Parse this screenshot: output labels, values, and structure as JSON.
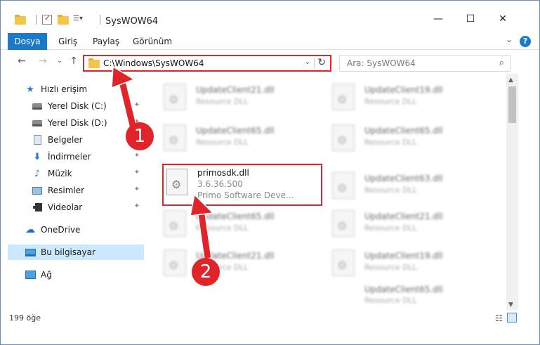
{
  "window": {
    "title": "SysWOW64",
    "minimize_glyph": "—",
    "maximize_glyph": "☐",
    "close_glyph": "✕"
  },
  "ribbon": {
    "tabs": [
      "Dosya",
      "Giriş",
      "Paylaş",
      "Görünüm"
    ],
    "help_glyph": "?",
    "expand_glyph": "⌄"
  },
  "address": {
    "path": "C:\\Windows\\SysWOW64",
    "dropdown_glyph": "⌄",
    "refresh_glyph": "↻"
  },
  "search": {
    "placeholder": "Ara: SysWOW64",
    "icon": "search-icon"
  },
  "nav_buttons": {
    "back": "←",
    "forward": "→",
    "recent": "⌄",
    "up": "↑"
  },
  "sidebar": {
    "items": [
      {
        "label": "Hızlı erişim",
        "icon": "star-icon"
      },
      {
        "label": "Yerel Disk (C:)",
        "icon": "drive-icon",
        "pinned": true
      },
      {
        "label": "Yerel Disk (D:)",
        "icon": "drive-icon",
        "pinned": true
      },
      {
        "label": "Belgeler",
        "icon": "document-icon",
        "pinned": true
      },
      {
        "label": "İndirmeler",
        "icon": "download-icon",
        "pinned": true
      },
      {
        "label": "Müzik",
        "icon": "music-icon",
        "pinned": true
      },
      {
        "label": "Resimler",
        "icon": "picture-icon",
        "pinned": true
      },
      {
        "label": "Videolar",
        "icon": "video-icon",
        "pinned": true
      },
      {
        "label": "OneDrive",
        "icon": "cloud-icon"
      },
      {
        "label": "Bu bilgisayar",
        "icon": "computer-icon",
        "selected": true
      },
      {
        "label": "Ağ",
        "icon": "network-icon"
      }
    ],
    "pin_glyph": "📌"
  },
  "files": {
    "left_column": [
      {
        "name": "UpdateClient21.dll",
        "type": "Resource DLL"
      },
      {
        "name": "UpdateClient65.dll",
        "type": "Resource DLL"
      },
      {
        "name": "UpdateClient65.dll",
        "type": "Resource DLL"
      },
      {
        "name": "UpdateClient21.dll",
        "type": "Resource DLL"
      }
    ],
    "right_column": [
      {
        "name": "UpdateClient19.dll",
        "type": "Resource DLL"
      },
      {
        "name": "UpdateClient65.dll",
        "type": "Resource DLL"
      },
      {
        "name": "UpdateClient63.dll",
        "type": "Resource DLL"
      },
      {
        "name": "UpdateClient21.dll",
        "type": "Resource DLL"
      },
      {
        "name": "UpdateClient19.dll",
        "type": "Resource DLL"
      },
      {
        "name": "UpdateClient65.dll",
        "type": "Resource DLL"
      }
    ],
    "highlighted": {
      "name": "primosdk.dll",
      "version": "3.6.36.500",
      "company": "Primo Software Deve..."
    }
  },
  "status": {
    "item_count": "199 öğe"
  },
  "annotations": {
    "callout_1": "1",
    "callout_2": "2",
    "accent": "#e0242a"
  }
}
